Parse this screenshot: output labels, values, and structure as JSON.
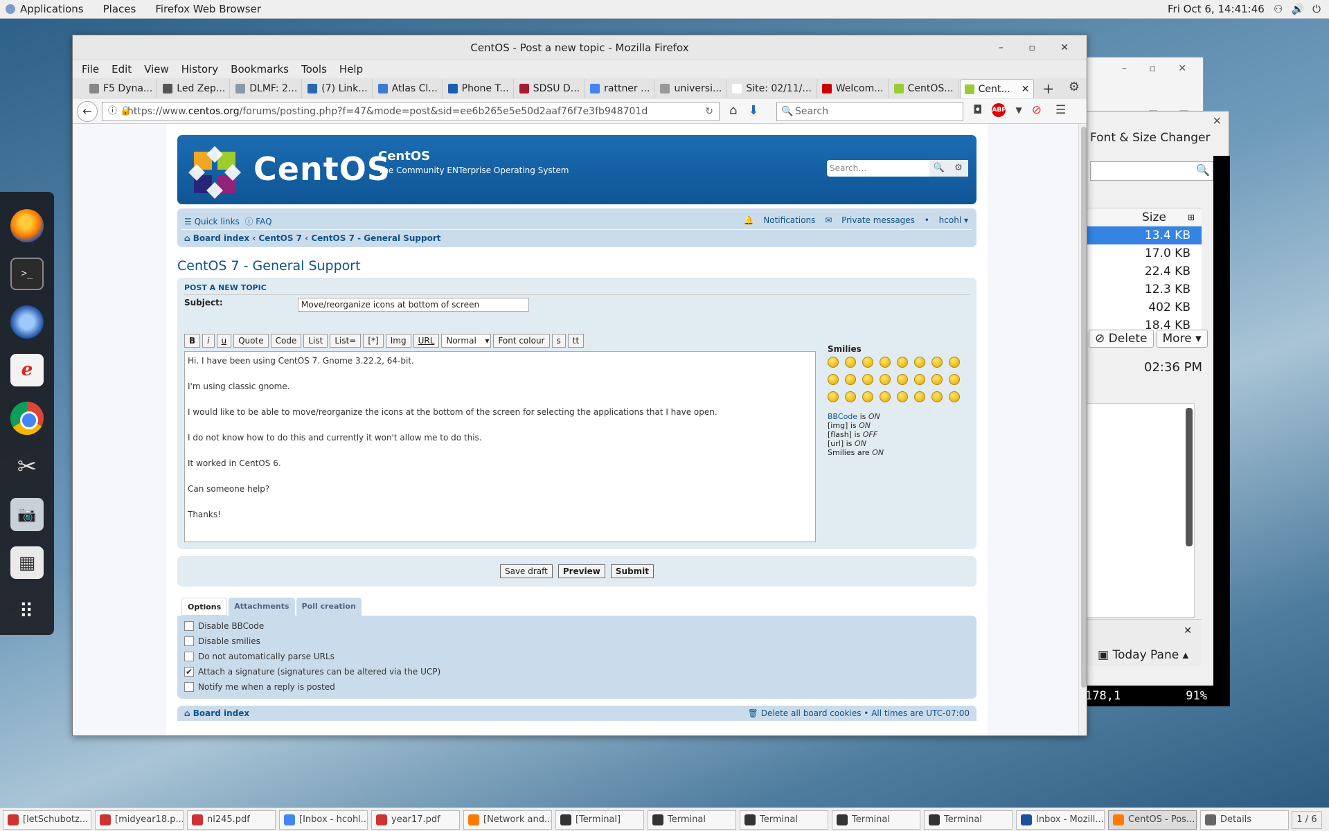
{
  "topbar": {
    "applications": "Applications",
    "places": "Places",
    "app": "Firefox Web Browser",
    "clock": "Fri Oct  6, 14:41:46"
  },
  "window": {
    "title": "CentOS - Post a new topic - Mozilla Firefox"
  },
  "menu": [
    "File",
    "Edit",
    "View",
    "History",
    "Bookmarks",
    "Tools",
    "Help"
  ],
  "tabs": [
    {
      "label": "F5 Dyna...",
      "color": "#888888"
    },
    {
      "label": "Led Zep...",
      "color": "#555555"
    },
    {
      "label": "DLMF: 2...",
      "color": "#8899aa"
    },
    {
      "label": "(7) Link...",
      "color": "#2867b2"
    },
    {
      "label": "Atlas Cl...",
      "color": "#3a7bd5"
    },
    {
      "label": "Phone T...",
      "color": "#1a5fb4"
    },
    {
      "label": "SDSU D...",
      "color": "#a6192e"
    },
    {
      "label": "rattner ...",
      "color": "#4285f4"
    },
    {
      "label": "universi...",
      "color": "#999999"
    },
    {
      "label": "Site: 02/11/...",
      "color": "#ffffff"
    },
    {
      "label": "Welcom...",
      "color": "#cc0000"
    },
    {
      "label": "CentOS...",
      "color": "#9c3"
    },
    {
      "label": "Cent...",
      "color": "#9c3"
    }
  ],
  "url": {
    "prefix": "https://www.",
    "host": "centos.org",
    "path": "/forums/posting.php?f=47&mode=post&sid=ee6b265e5e50d2aaf76f7e3fb948701d"
  },
  "search": {
    "placeholder": "Search"
  },
  "site": {
    "logo": "CentOS",
    "name": "CentOS",
    "desc": "The Community ENTerprise Operating System",
    "search_placeholder": "Search…"
  },
  "nav": {
    "quick_links": "Quick links",
    "faq": "FAQ",
    "notifications": "Notifications",
    "private_messages": "Private messages",
    "user": "hcohl",
    "breadcrumb": [
      "Board index",
      "CentOS 7",
      "CentOS 7 - General Support"
    ]
  },
  "forum": {
    "title": "CentOS 7 - General Support",
    "panel_title": "POST A NEW TOPIC",
    "subject_label": "Subject:",
    "subject_value": "Move/reorganize icons at bottom of screen"
  },
  "toolbar": [
    "B",
    "i",
    "u",
    "Quote",
    "Code",
    "List",
    "List=",
    "[*]",
    "Img",
    "URL",
    "Normal",
    "Font colour",
    "s",
    "tt"
  ],
  "message": [
    "Hi. I have been using CentOS 7. Gnome 3.22.2, 64-bit.",
    "I'm using classic gnome.",
    "I would like to be able to move/reorganize the icons at the bottom of the screen for selecting the applications that I have open.",
    "I do not know how to do this and currently it won't allow me to do this.",
    "It worked in CentOS 6.",
    "Can someone help?",
    "Thanks!"
  ],
  "smilies": {
    "title": "Smilies",
    "count": 24
  },
  "bbinfo": {
    "bbcode": "BBCode",
    "is": "is",
    "on": "ON",
    "img": "[img] is",
    "flash": "[flash] is",
    "off": "OFF",
    "url": "[url] is",
    "smilies": "Smilies are"
  },
  "actions": {
    "save_draft": "Save draft",
    "preview": "Preview",
    "submit": "Submit"
  },
  "option_tabs": [
    "Options",
    "Attachments",
    "Poll creation"
  ],
  "options": [
    {
      "label": "Disable BBCode",
      "checked": false
    },
    {
      "label": "Disable smilies",
      "checked": false
    },
    {
      "label": "Do not automatically parse URLs",
      "checked": false
    },
    {
      "label": "Attach a signature (signatures can be altered via the UCP)",
      "checked": true
    },
    {
      "label": "Notify me when a reply is posted",
      "checked": false
    }
  ],
  "footer": {
    "board_index": "Board index",
    "delete_cookies": "Delete all board cookies",
    "times": "All times are UTC-07:00"
  },
  "side": {
    "font_size_changer": "Font & Size Changer",
    "size_header": "Size",
    "sizes": [
      "13.4 KB",
      "17.0 KB",
      "22.4 KB",
      "12.3 KB",
      "402 KB",
      "18.4 KB"
    ],
    "delete": "Delete",
    "more": "More",
    "time": "02:36 PM",
    "today_pane": "Today Pane",
    "status_pos": "178,1",
    "status_pct": "91%"
  },
  "taskbar": [
    {
      "label": "[letSchubotz...",
      "color": "#cc3333"
    },
    {
      "label": "[midyear18.p...",
      "color": "#cc3333"
    },
    {
      "label": "nl245.pdf",
      "color": "#cc3333"
    },
    {
      "label": "[Inbox - hcohl...",
      "color": "#4285f4"
    },
    {
      "label": "year17.pdf",
      "color": "#cc3333"
    },
    {
      "label": "[Network and...",
      "color": "#ff7b00"
    },
    {
      "label": "[Terminal]",
      "color": "#333333"
    },
    {
      "label": "Terminal",
      "color": "#333333"
    },
    {
      "label": "Terminal",
      "color": "#333333"
    },
    {
      "label": "Terminal",
      "color": "#333333"
    },
    {
      "label": "Terminal",
      "color": "#333333"
    },
    {
      "label": "Inbox - Mozill...",
      "color": "#1e4f9e"
    },
    {
      "label": "CentOS - Pos...",
      "color": "#ff7b00"
    },
    {
      "label": "Details",
      "color": "#666666"
    }
  ],
  "pager": "1 / 6"
}
